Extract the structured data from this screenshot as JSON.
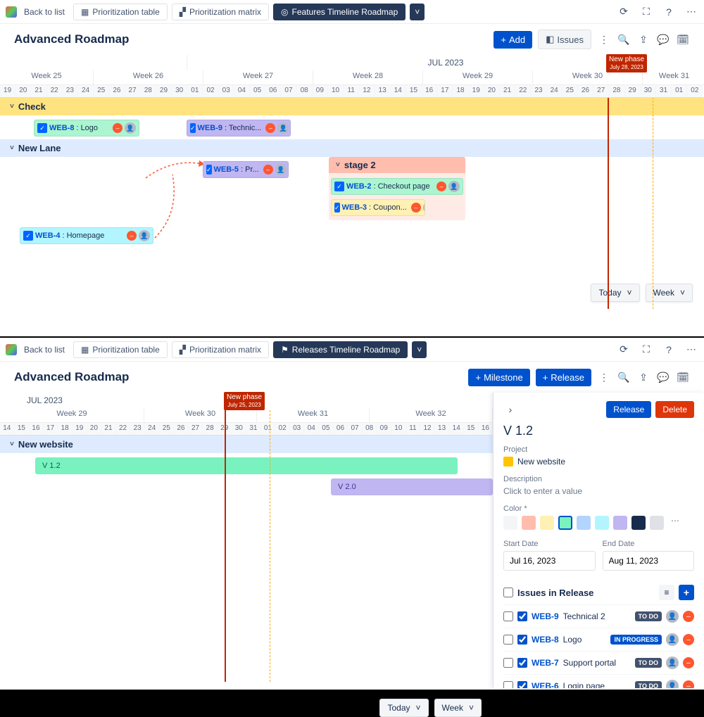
{
  "top": {
    "back": "Back to list",
    "tabs": {
      "prior_table": "Prioritization table",
      "prior_matrix": "Prioritization matrix",
      "features_timeline": "Features Timeline Roadmap"
    },
    "title": "Advanced Roadmap",
    "add_btn": "Add",
    "issues_btn": "Issues",
    "month": "JUL 2023",
    "weeks": [
      "Week 25",
      "Week 26",
      "Week 27",
      "Week 28",
      "Week 29",
      "Week 30",
      "Week 31"
    ],
    "days": [
      "19",
      "20",
      "21",
      "22",
      "23",
      "24",
      "25",
      "26",
      "27",
      "28",
      "29",
      "30",
      "01",
      "02",
      "03",
      "04",
      "05",
      "06",
      "07",
      "08",
      "09",
      "10",
      "11",
      "12",
      "13",
      "14",
      "15",
      "16",
      "17",
      "18",
      "19",
      "20",
      "21",
      "22",
      "23",
      "24",
      "25",
      "26",
      "27",
      "28",
      "29",
      "30",
      "31",
      "01",
      "02"
    ],
    "marker": {
      "title": "New phase",
      "date": "July 28, 2023"
    },
    "lanes": {
      "check": "Check",
      "new_lane": "New Lane",
      "stage2": "stage 2"
    },
    "cards": {
      "web8": {
        "key": "WEB-8",
        "summary": ": Logo"
      },
      "web9": {
        "key": "WEB-9",
        "summary": ": Technic..."
      },
      "web5": {
        "key": "WEB-5",
        "summary": ": Pr..."
      },
      "web2": {
        "key": "WEB-2",
        "summary": ": Checkout page"
      },
      "web3": {
        "key": "WEB-3",
        "summary": ": Coupon..."
      },
      "web4": {
        "key": "WEB-4",
        "summary": ": Homepage"
      }
    },
    "today": "Today",
    "week_sel": "Week"
  },
  "bottom": {
    "back": "Back to list",
    "tabs": {
      "prior_table": "Prioritization table",
      "prior_matrix": "Prioritization matrix",
      "releases_timeline": "Releases Timeline Roadmap"
    },
    "title": "Advanced Roadmap",
    "milestone_btn": "Milestone",
    "release_btn": "Release",
    "month": "JUL 2023",
    "weeks": [
      "Week 29",
      "Week 30",
      "Week 31",
      "Week 32"
    ],
    "days": [
      "14",
      "15",
      "16",
      "17",
      "18",
      "19",
      "20",
      "21",
      "22",
      "23",
      "24",
      "25",
      "26",
      "27",
      "28",
      "29",
      "30",
      "31",
      "01",
      "02",
      "03",
      "04",
      "05",
      "06",
      "07",
      "08",
      "09",
      "10",
      "11",
      "12",
      "13",
      "14",
      "15",
      "16"
    ],
    "marker": {
      "title": "New phase",
      "date": "July 25, 2023"
    },
    "lane": "New website",
    "bars": {
      "v12": "V 1.2",
      "v20": "V 2.0"
    },
    "today": "Today",
    "week_sel": "Week",
    "side": {
      "release_btn": "Release",
      "delete_btn": "Delete",
      "title": "V 1.2",
      "project_label": "Project",
      "project_name": "New website",
      "desc_label": "Description",
      "desc_placeholder": "Click to enter a value",
      "color_label": "Color *",
      "colors": [
        "#f4f5f7",
        "#ffbdad",
        "#fff0b3",
        "#79f2c0",
        "#b3d4ff",
        "#b3f5ff",
        "#c0b6f2",
        "#172b4d",
        "#dfe1e6"
      ],
      "selected_color": 3,
      "start_date_label": "Start Date",
      "start_date": "Jul 16, 2023",
      "end_date_label": "End Date",
      "end_date": "Aug 11, 2023",
      "issues_title": "Issues in Release",
      "issues": [
        {
          "key": "WEB-9",
          "name": "Technical 2",
          "status": "TO DO",
          "status_class": "lozenge-todo"
        },
        {
          "key": "WEB-8",
          "name": "Logo",
          "status": "IN PROGRESS",
          "status_class": "lozenge-progress"
        },
        {
          "key": "WEB-7",
          "name": "Support portal",
          "status": "TO DO",
          "status_class": "lozenge-todo"
        },
        {
          "key": "WEB-6",
          "name": "Login page",
          "status": "TO DO",
          "status_class": "lozenge-todo"
        }
      ]
    }
  }
}
